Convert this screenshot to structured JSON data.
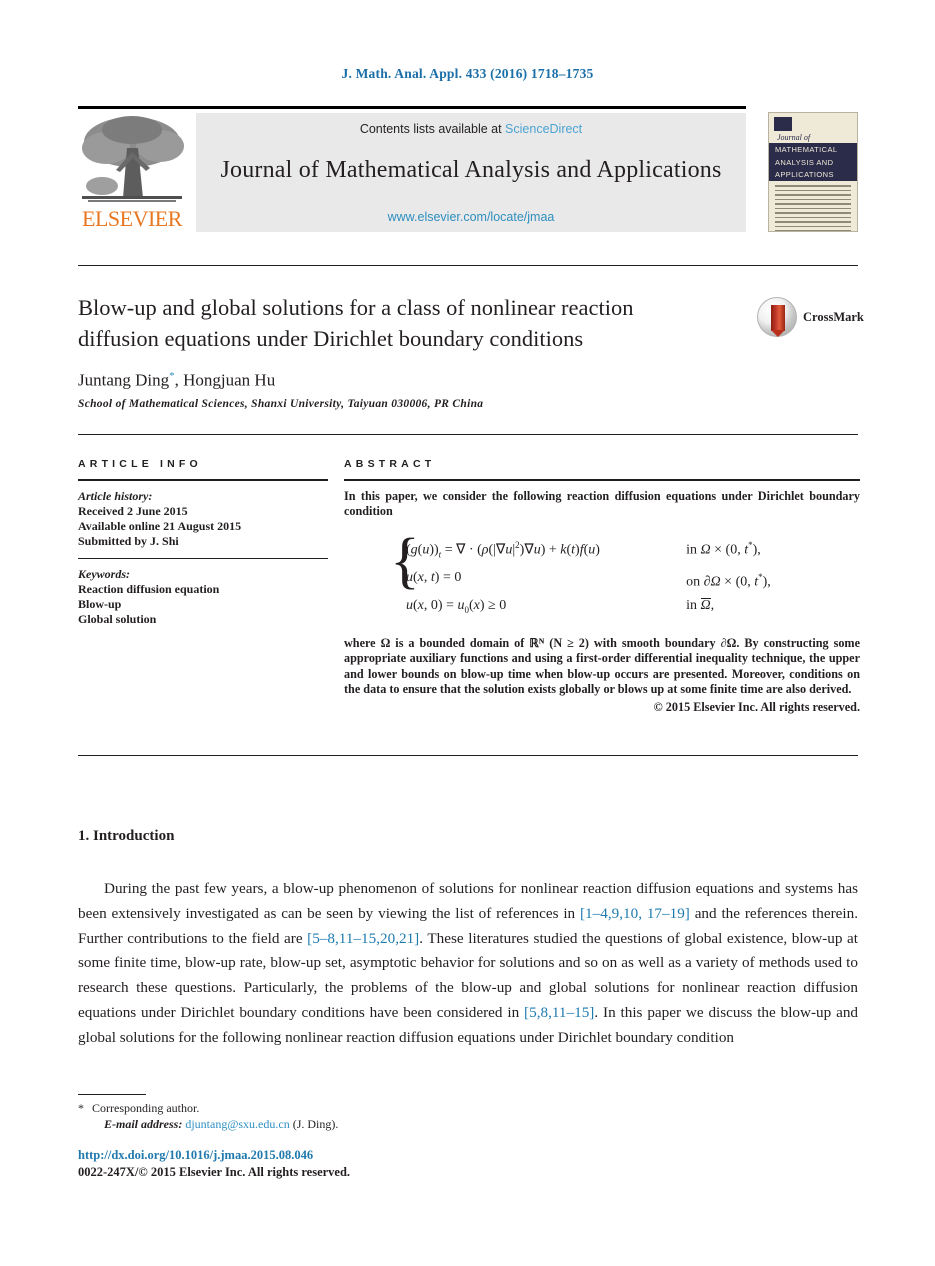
{
  "running_head": "J. Math. Anal. Appl. 433 (2016) 1718–1735",
  "masthead": {
    "contents_prefix": "Contents lists available at ",
    "sciencedirect": "ScienceDirect",
    "journal_title": "Journal of Mathematical Analysis and Applications",
    "journal_url": "www.elsevier.com/locate/jmaa",
    "publisher": "ELSEVIER",
    "cover": {
      "journal_of": "Journal of",
      "band_line1": "MATHEMATICAL",
      "band_line2": "ANALYSIS AND",
      "band_line3": "APPLICATIONS"
    }
  },
  "article": {
    "title_line1": "Blow-up and global solutions for a class of nonlinear reaction",
    "title_line2": "diffusion equations under Dirichlet boundary conditions",
    "crossmark_label": "CrossMark",
    "authors": "Juntang Ding",
    "author_marker": "*",
    "authors_rest": ", Hongjuan Hu",
    "affiliation": "School of Mathematical Sciences, Shanxi University, Taiyuan 030006, PR China"
  },
  "info": {
    "heading": "ARTICLE INFO",
    "history_label": "Article history:",
    "history": [
      "Received 2 June 2015",
      "Available online 21 August 2015",
      "Submitted by J. Shi"
    ],
    "keywords_label": "Keywords:",
    "keywords": [
      "Reaction diffusion equation",
      "Blow-up",
      "Global solution"
    ]
  },
  "abstract": {
    "heading": "ABSTRACT",
    "intro": "In this paper, we consider the following reaction diffusion equations under Dirichlet boundary condition",
    "equation": {
      "rows": [
        {
          "lhs": "(g(u))_t = ∇ · (ρ(|∇u|²)∇u) + k(t)f(u)",
          "rhs": "in Ω × (0, t*),"
        },
        {
          "lhs": "u(x, t) = 0",
          "rhs": "on ∂Ω × (0, t*),"
        },
        {
          "lhs": "u(x, 0) = u₀(x) ≥ 0",
          "rhs": "in Ω̄,"
        }
      ]
    },
    "body": "where Ω is a bounded domain of ℝᴺ (N ≥ 2) with smooth boundary ∂Ω. By constructing some appropriate auxiliary functions and using a first-order differential inequality technique, the upper and lower bounds on blow-up time when blow-up occurs are presented. Moreover, conditions on the data to ensure that the solution exists globally or blows up at some finite time are also derived.",
    "copyright": "© 2015 Elsevier Inc. All rights reserved."
  },
  "section": {
    "number_title": "1.  Introduction",
    "para_part1": "During the past few years, a blow-up phenomenon of solutions for nonlinear reaction diffusion equations and systems has been extensively investigated as can be seen by viewing the list of references in ",
    "ref1": "[1–4,9,10, 17–19]",
    "para_part2": " and the references therein. Further contributions to the field are ",
    "ref2": "[5–8,11–15,20,21]",
    "para_part3": ". These literatures studied the questions of global existence, blow-up at some finite time, blow-up rate, blow-up set, asymptotic behavior for solutions and so on as well as a variety of methods used to research these questions. Particularly, the problems of the blow-up and global solutions for nonlinear reaction diffusion equations under Dirichlet boundary conditions have been considered in ",
    "ref3": "[5,8,11–15]",
    "para_part4": ". In this paper we discuss the blow-up and global solutions for the following nonlinear reaction diffusion equations under Dirichlet boundary condition"
  },
  "footer": {
    "corresponding_marker": "*",
    "corresponding": "Corresponding author.",
    "email_label": "E-mail address:",
    "email": "djuntang@sxu.edu.cn",
    "email_owner": "(J. Ding).",
    "doi": "http://dx.doi.org/10.1016/j.jmaa.2015.08.046",
    "issn": "0022-247X/© 2015 Elsevier Inc. All rights reserved."
  },
  "colors": {
    "link_blue": "#1e7bb0",
    "sciencedirect_blue": "#4ba3d3",
    "url_blue": "#2e8fc0",
    "elsevier_orange": "#e87722",
    "cover_navy": "#2b2b4a"
  }
}
